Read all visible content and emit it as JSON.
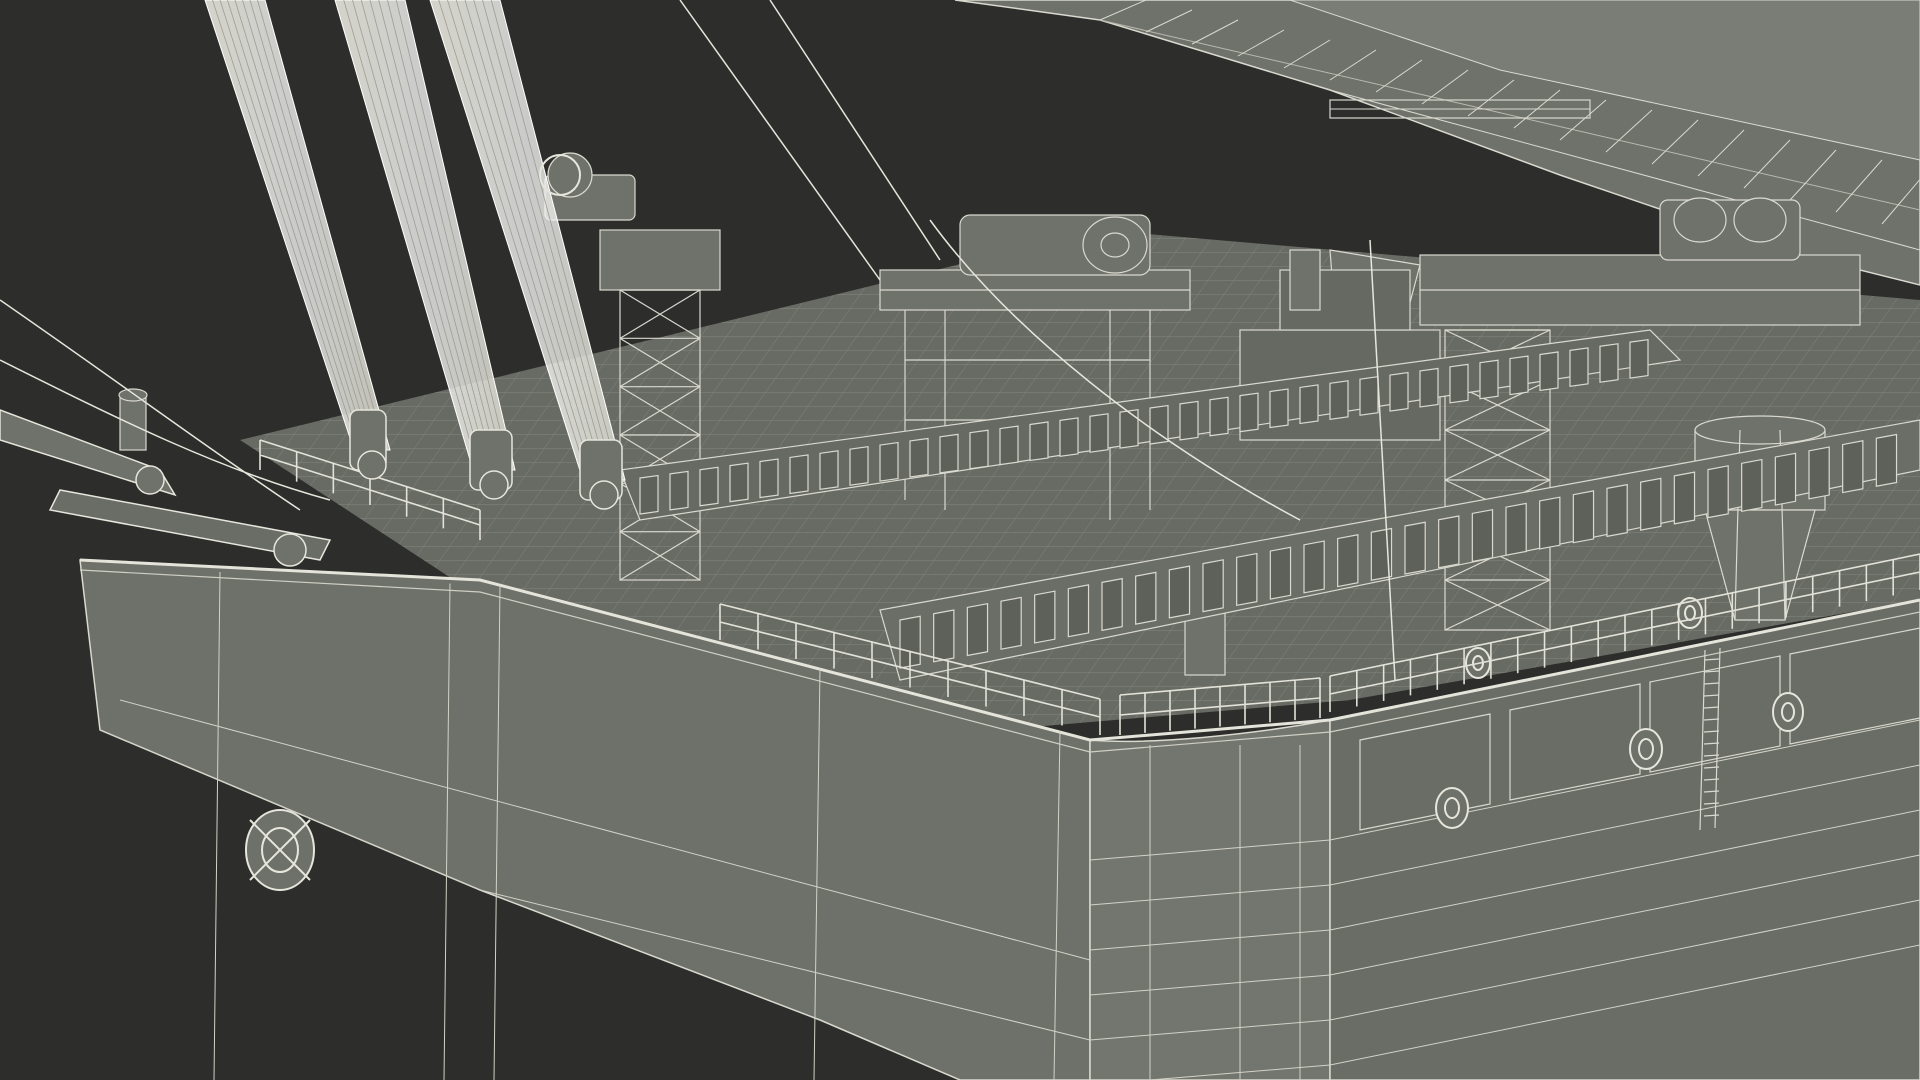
{
  "scene": {
    "subject": "barge-crane-wireframe",
    "colors": {
      "background": "#2d2d2b",
      "hull": "#6f716b",
      "hull_dark": "#5d5f5a",
      "hull_light": "#7d7f79",
      "wire": "#d9d9cf",
      "wire_dim": "#b9b9ae",
      "deck": "#666862"
    }
  }
}
